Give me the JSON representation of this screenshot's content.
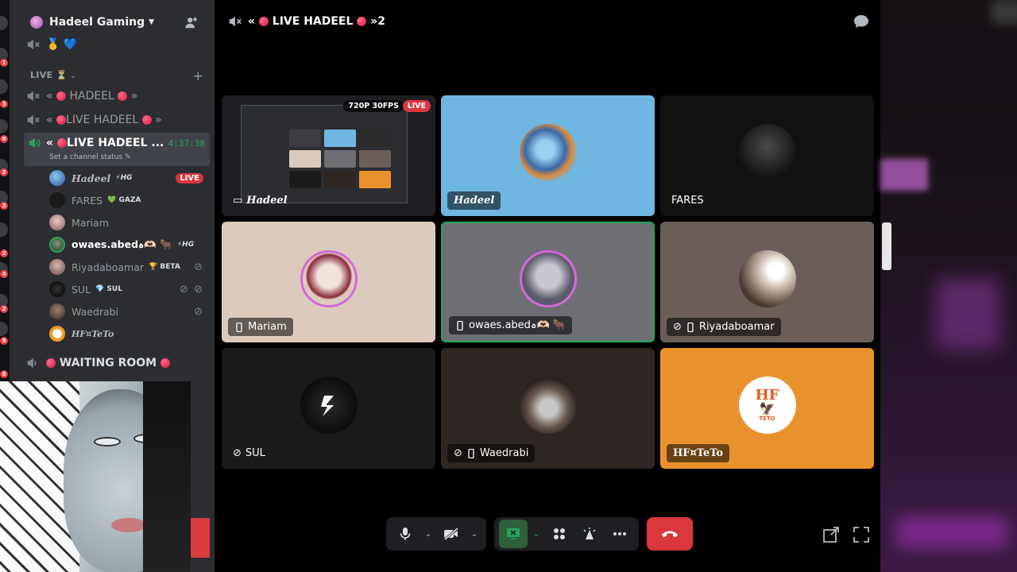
{
  "server": {
    "name": "Hadeel Gaming"
  },
  "sidebar": {
    "top_channel_emojis": "🥇 💙",
    "category": "LIVE ⏳",
    "channels": [
      {
        "prefix": "«",
        "label": "HADEEL",
        "suffix": "»"
      },
      {
        "prefix": "«",
        "label": "LIVE HADEEL",
        "suffix": "»"
      }
    ],
    "active_channel": {
      "prefix": "«",
      "label": "LIVE HADEEL ...",
      "timer": "4:37:38",
      "status": "Set a channel status"
    },
    "users": [
      {
        "name": "Hadeel",
        "tag": "⚡HG",
        "badge": "LIVE",
        "avatar_color": "#4a86c8"
      },
      {
        "name": "FARES",
        "tag": "💚 GAZA",
        "avatar_color": "#222"
      },
      {
        "name": "Mariam",
        "tag": "",
        "avatar_color": "#c9a8a2"
      },
      {
        "name": "owaes.abedہ🫶🏻 🐂",
        "tag": "⚡HG",
        "avatar_color": "#5a7a5a"
      },
      {
        "name": "Riyadaboamar",
        "tag": "🏆 BETA",
        "avatar_color": "#a88"
      },
      {
        "name": "SUL",
        "tag": "💎 SUL",
        "avatar_color": "#111"
      },
      {
        "name": "Waedrabi",
        "tag": "",
        "avatar_color": "#6b5548"
      },
      {
        "name": "HF¤TeTo",
        "tag": "",
        "avatar_color": "#f39a2a"
      }
    ],
    "waiting_room": "WAITING ROOM"
  },
  "topbar": {
    "prefix": "«",
    "title": "LIVE HADEEL",
    "suffix": "»2"
  },
  "tiles": [
    {
      "name": "Hadeel",
      "quality": "720P 30FPS",
      "live": "LIVE",
      "bg": "#1e1f22"
    },
    {
      "name": "Hadeel",
      "bg": "#6fb6e0"
    },
    {
      "name": "FARES",
      "bg": "#111111"
    },
    {
      "name": "Mariam",
      "bg": "#dccbbd"
    },
    {
      "name": "owaes.abedہ🫶🏻 🐂",
      "bg": "#6e6f75"
    },
    {
      "name": "Riyadaboamar",
      "bg": "#6b5e58"
    },
    {
      "name": "SUL",
      "bg": "#1a1a1a"
    },
    {
      "name": "Waedrabi",
      "bg": "#2e2623"
    },
    {
      "name": "HF¤TeTo",
      "bg": "#e8922e",
      "logo_text": "HF",
      "logo_sub": "TETO"
    }
  ],
  "colors": {
    "accent_green": "#23a55a",
    "danger": "#da373c",
    "sidebar_bg": "#2b2d31"
  }
}
